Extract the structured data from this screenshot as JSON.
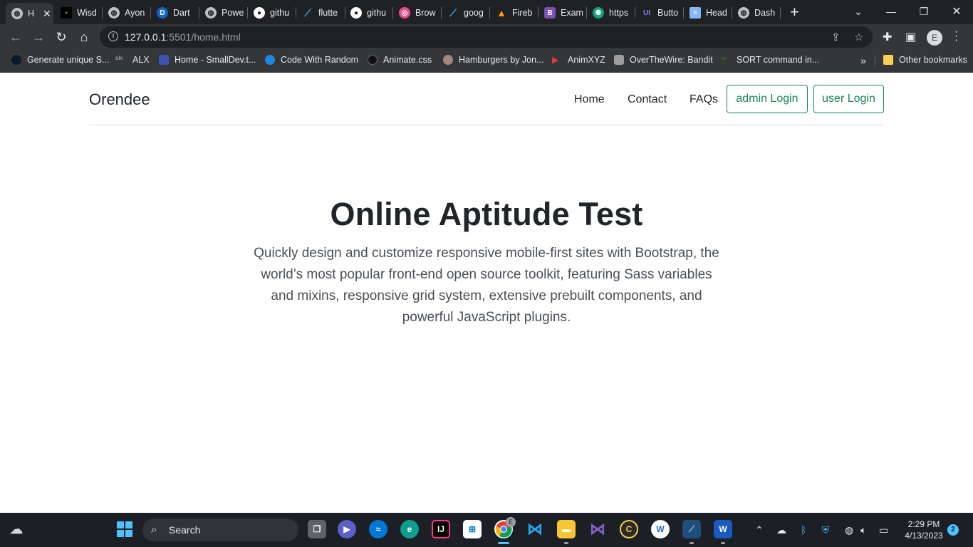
{
  "browser": {
    "tabs": [
      {
        "label": "H",
        "icon": "globe-icon",
        "color": "#5f6368"
      },
      {
        "label": "Wisd",
        "icon": "terminal-icon",
        "color": "#000000"
      },
      {
        "label": "Ayon",
        "icon": "globe-icon",
        "color": "#5f6368"
      },
      {
        "label": "Dart",
        "icon": "dart-icon",
        "color": "#1565c0"
      },
      {
        "label": "Powe",
        "icon": "globe-icon",
        "color": "#5f6368"
      },
      {
        "label": "githu",
        "icon": "github-icon",
        "color": "#ffffff"
      },
      {
        "label": "flutte",
        "icon": "flutter-icon",
        "color": "#42a5f5"
      },
      {
        "label": "githu",
        "icon": "github-icon",
        "color": "#ffffff"
      },
      {
        "label": "Brow",
        "icon": "dribbble-icon",
        "color": "#ea4c89"
      },
      {
        "label": "goog",
        "icon": "flutter-icon",
        "color": "#42a5f5"
      },
      {
        "label": "Fireb",
        "icon": "firebase-icon",
        "color": "#ffa000"
      },
      {
        "label": "Exam",
        "icon": "bootstrap-icon",
        "color": "#7952b3"
      },
      {
        "label": "https",
        "icon": "openai-icon",
        "color": "#10a37f"
      },
      {
        "label": "Butto",
        "icon": "ui-icon",
        "color": "#6b4eff"
      },
      {
        "label": "Head",
        "icon": "doc-icon",
        "color": "#8ab4f8"
      },
      {
        "label": "Dash",
        "icon": "globe-icon",
        "color": "#5f6368"
      }
    ],
    "new_tab_label": "+",
    "url_host": "127.0.0.1",
    "url_path": ":5501/home.html",
    "profile_initial": "E",
    "bookmarks": [
      {
        "label": "Generate unique S...",
        "color": "#0b1a2b"
      },
      {
        "label": "ALX",
        "color": "#35363a"
      },
      {
        "label": "Home - SmallDev.t...",
        "color": "#3f51b5"
      },
      {
        "label": "Code With Random",
        "color": "#1e88e5"
      },
      {
        "label": "Animate.css",
        "color": "#111111"
      },
      {
        "label": "Hamburgers by Jon...",
        "color": "#a1887f"
      },
      {
        "label": "AnimXYZ",
        "color": "#e53935"
      },
      {
        "label": "OverTheWire: Bandit",
        "color": "#9e9e9e"
      },
      {
        "label": "SORT command in...",
        "color": "#2e7d32"
      }
    ],
    "bookmarks_more": "»",
    "other_bookmarks": "Other bookmarks"
  },
  "site": {
    "brand": "Orendee",
    "nav": {
      "home": "Home",
      "contact": "Contact",
      "faqs": "FAQs",
      "admin_login": "admin Login",
      "user_login": "user Login"
    },
    "hero": {
      "title": "Online Aptitude Test",
      "lead": "Quickly design and customize responsive mobile-first sites with Bootstrap, the world’s most popular front-end open source toolkit, featuring Sass variables and mixins, responsive grid system, extensive prebuilt components, and powerful JavaScript plugins."
    },
    "accent_color": "#198754"
  },
  "taskbar": {
    "search_label": "Search",
    "time": "2:29 PM",
    "date": "4/13/2023",
    "notification_count": "2",
    "chrome_badge": "E"
  }
}
